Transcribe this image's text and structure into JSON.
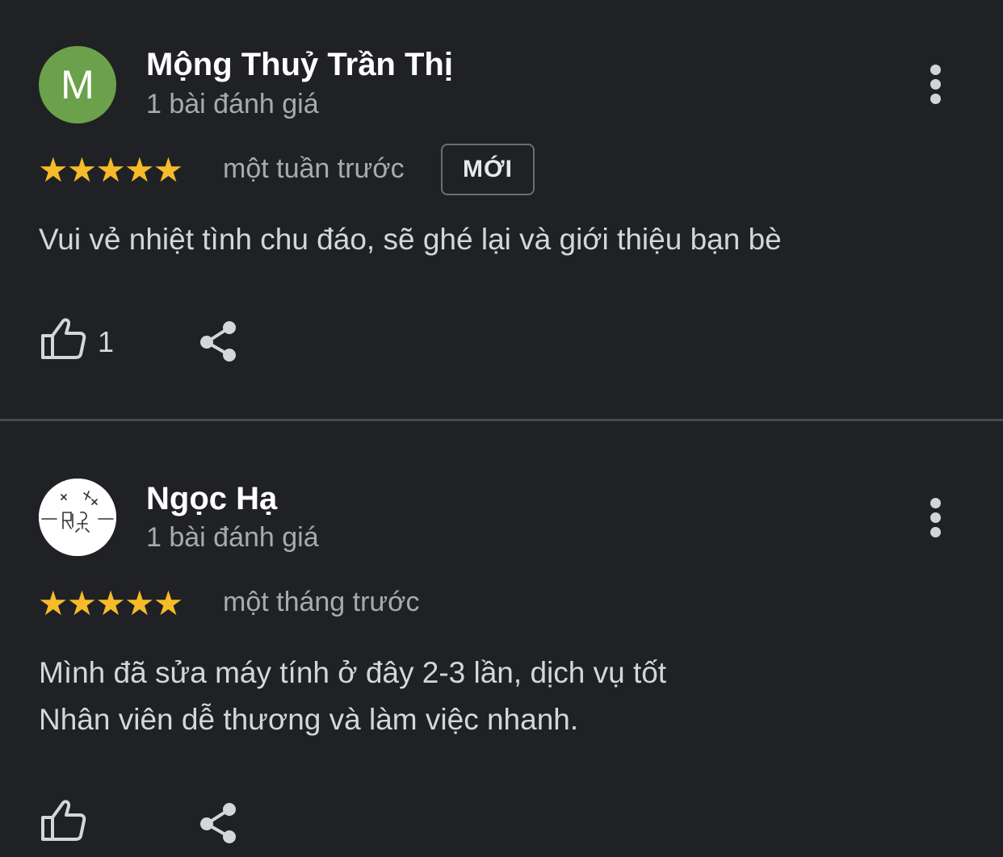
{
  "reviews": [
    {
      "avatar_letter": "M",
      "avatar_color": "#6aa14a",
      "name": "Mộng Thuỷ Trần Thị",
      "review_count": "1 bài đánh giá",
      "stars": "★★★★★",
      "rating": 5,
      "time": "một tuần trước",
      "badge": "MỚI",
      "text_lines": [
        "Vui vẻ nhiệt tình chu đáo, sẽ ghé lại và giới thiệu bạn bè"
      ],
      "like_count": "1"
    },
    {
      "avatar_icon": "sketch-avatar-image",
      "name": "Ngọc Hạ",
      "review_count": "1 bài đánh giá",
      "stars": "★★★★★",
      "rating": 5,
      "time": "một tháng trước",
      "text_lines": [
        "Mình đã sửa máy tính ở đây 2-3 lần, dịch vụ tốt",
        "Nhân viên dễ thương và làm việc nhanh."
      ]
    }
  ],
  "icons": {
    "more": "more-vert-icon",
    "like": "thumbs-up-icon",
    "share": "share-icon",
    "star": "star-icon"
  },
  "colors": {
    "background": "#202124",
    "star": "#f6bb29",
    "divider": "#4a4b4f"
  }
}
